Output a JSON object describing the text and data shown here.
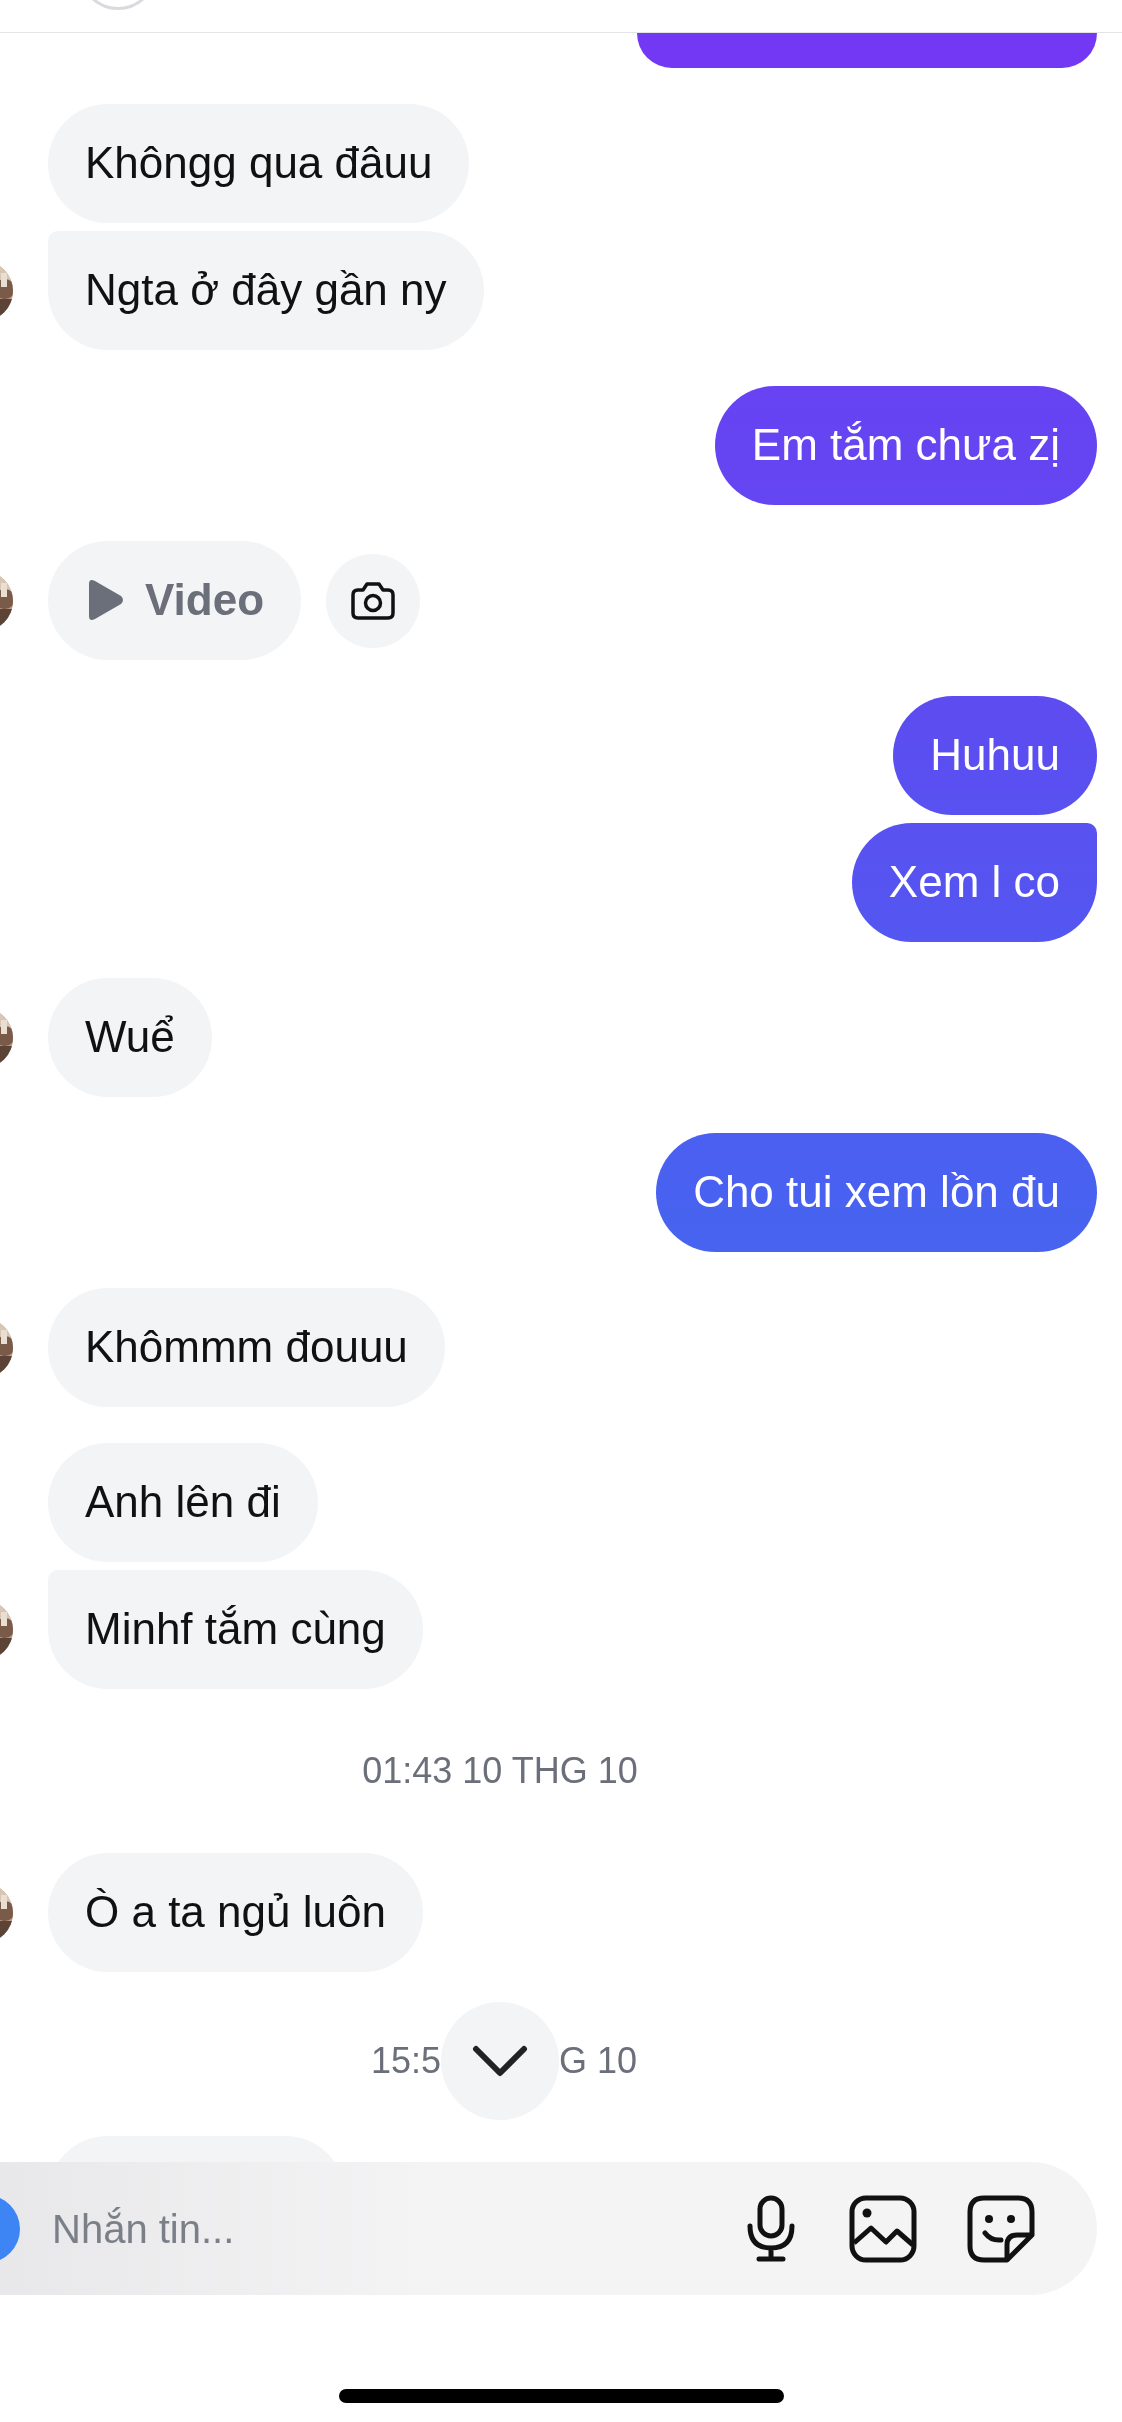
{
  "messages": [
    {
      "kind": "cutoff",
      "outgoing": true
    },
    {
      "kind": "text",
      "outgoing": false,
      "text": "Khôngg qua đâuu",
      "avatar": false
    },
    {
      "kind": "text",
      "outgoing": false,
      "text": "Ngta ở đây gần ny",
      "avatar": true
    },
    {
      "kind": "text",
      "outgoing": true,
      "text": "Em tắm chưa zị"
    },
    {
      "kind": "media",
      "outgoing": false,
      "label": "Video",
      "camera": true,
      "avatar": true
    },
    {
      "kind": "text",
      "outgoing": true,
      "text": "Huhuu"
    },
    {
      "kind": "text",
      "outgoing": true,
      "text": "Xem l co"
    },
    {
      "kind": "text",
      "outgoing": false,
      "text": "Wuể",
      "avatar": true
    },
    {
      "kind": "text",
      "outgoing": true,
      "text": "Cho tui xem lồn đu"
    },
    {
      "kind": "text",
      "outgoing": false,
      "text": "Khômmm đouuu",
      "avatar": true
    },
    {
      "kind": "text",
      "outgoing": false,
      "text": "Anh lên đi",
      "avatar": false
    },
    {
      "kind": "text",
      "outgoing": false,
      "text": "Minhf tắm cùng",
      "avatar": true
    },
    {
      "kind": "time",
      "parts": [
        "01:43 10 THG 10"
      ]
    },
    {
      "kind": "text",
      "outgoing": false,
      "text": "Ò a ta ngủ luôn",
      "avatar": true
    },
    {
      "kind": "time",
      "parts": [
        "15:5",
        "G 10"
      ],
      "scroll_button": true
    },
    {
      "kind": "cutoff",
      "outgoing": false
    }
  ],
  "composer": {
    "placeholder": "Nhắn tin..."
  }
}
